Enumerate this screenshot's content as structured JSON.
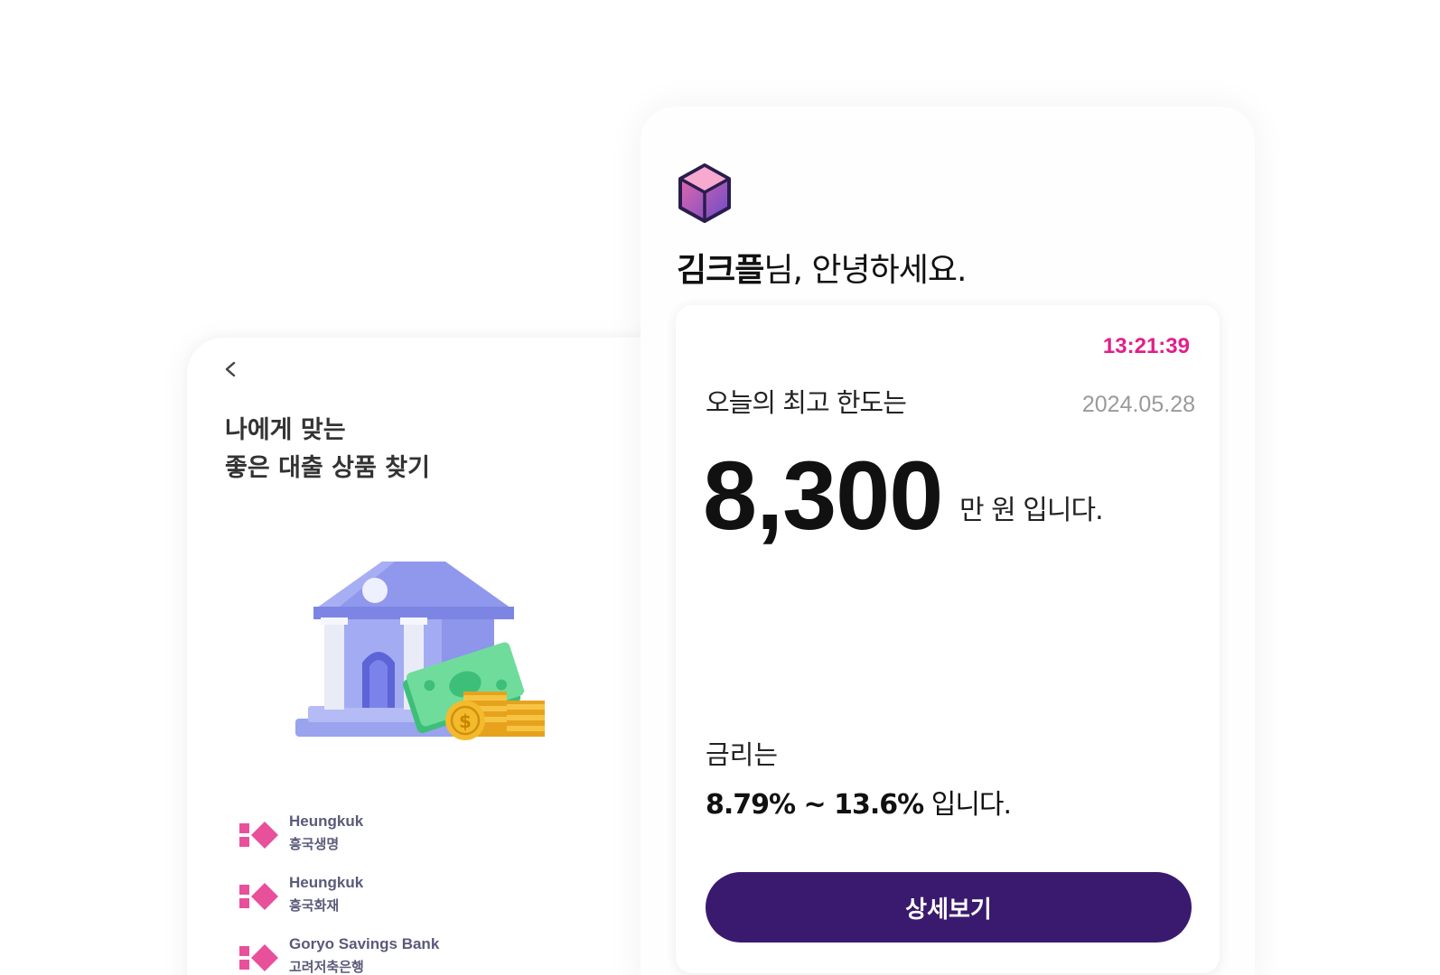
{
  "colors": {
    "accent_pink": "#e0208a",
    "primary_purple": "#3a1a6e",
    "lender_logo_pink": "#e8509b"
  },
  "back_screen": {
    "back_icon": "chevron-left-icon",
    "title_line1": "나에게 맞는",
    "title_line2": "좋은 대출 상품 찾기",
    "illustration": "bank-building-with-money-illustration",
    "lenders": [
      {
        "name_en": "Heungkuk",
        "name_kr": "흥국생명"
      },
      {
        "name_en": "Heungkuk",
        "name_kr": "흥국화재"
      },
      {
        "name_en": "Goryo Savings Bank",
        "name_kr": "고려저축은행"
      }
    ]
  },
  "front_screen": {
    "logo_icon": "cube-logo-icon",
    "user_name": "김크플",
    "greeting_suffix": "님, 안녕하세요.",
    "card": {
      "clock": "13:21:39",
      "limit_label": "오늘의 최고 한도는",
      "date": "2024.05.28",
      "amount": "8,300",
      "amount_suffix": "만 원 입니다.",
      "rate_label": "금리는",
      "rate_range": "8.79% ~ 13.6%",
      "rate_suffix": " 입니다.",
      "detail_button": "상세보기"
    }
  }
}
